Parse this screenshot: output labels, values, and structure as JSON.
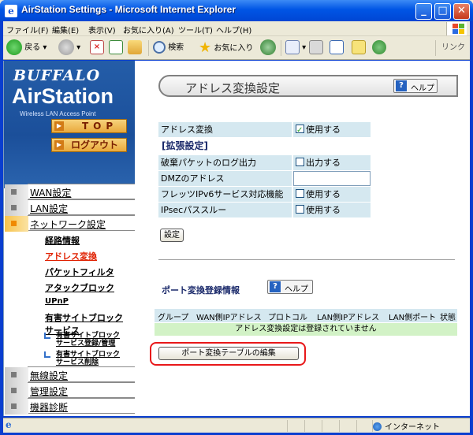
{
  "window": {
    "title": "AirStation Settings - Microsoft Internet Explorer",
    "min": "_",
    "max": "□",
    "close": "✕"
  },
  "menu": [
    "ファイル(F)",
    "編集(E)",
    "表示(V)",
    "お気に入り(A)",
    "ツール(T)",
    "ヘルプ(H)"
  ],
  "toolbar": {
    "back": "戻る",
    "search": "検索",
    "favorites": "お気に入り",
    "links": "リンク"
  },
  "brand": {
    "company": "BUFFALO",
    "product": "AirStation",
    "tagline": "Wireless LAN Access Point",
    "top_label": "TOP",
    "logout_label": "ログアウト"
  },
  "nav": {
    "wan": "WAN設定",
    "lan": "LAN設定",
    "network": "ネットワーク設定",
    "routing": "経路情報",
    "address_translation": "アドレス変換",
    "packet_filter": "パケットフィルタ",
    "attack_block": "アタックブロック",
    "upnp": "UPnP",
    "harmful_block_1": "有害サイトブロック",
    "harmful_block_2": "サービス",
    "harmful_reg_1": "有害サイトブロック",
    "harmful_reg_2": "サービス登録/管理",
    "harmful_del_1": "有害サイトブロック",
    "harmful_del_2": "サービス削除",
    "wireless": "無線設定",
    "admin": "管理設定",
    "diagnostics": "機器診断"
  },
  "main": {
    "page_title": "アドレス変換設定",
    "help_label": "ヘルプ",
    "rows": {
      "address_translation_label": "アドレス変換",
      "address_translation_value": "使用する",
      "extended_heading": "[拡張設定]",
      "discard_log_label": "破棄パケットのログ出力",
      "discard_log_value": "出力する",
      "dmz_label": "DMZのアドレス",
      "dmz_value": "",
      "flets_label": "フレッツIPv6サービス対応機能",
      "flets_value": "使用する",
      "ipsec_label": "IPsecパススルー",
      "ipsec_value": "使用する"
    },
    "set_button": "設定",
    "port_section_title": "ポート変換登録情報",
    "port_help_label": "ヘルプ",
    "table_headers": [
      "グループ",
      "WAN側IPアドレス",
      "プロトコル",
      "LAN側IPアドレス",
      "LAN側ポート",
      "状態"
    ],
    "table_empty": "アドレス変換設定は登録されていません",
    "edit_button": "ポート変換テーブルの編集"
  },
  "status": {
    "zone": "インターネット"
  },
  "colors": {
    "xp_blue": "#0055e5",
    "highlight_ring": "#e8181a",
    "table_bg": "#d5e8f0",
    "empty_row_bg": "#d2f2c6"
  }
}
